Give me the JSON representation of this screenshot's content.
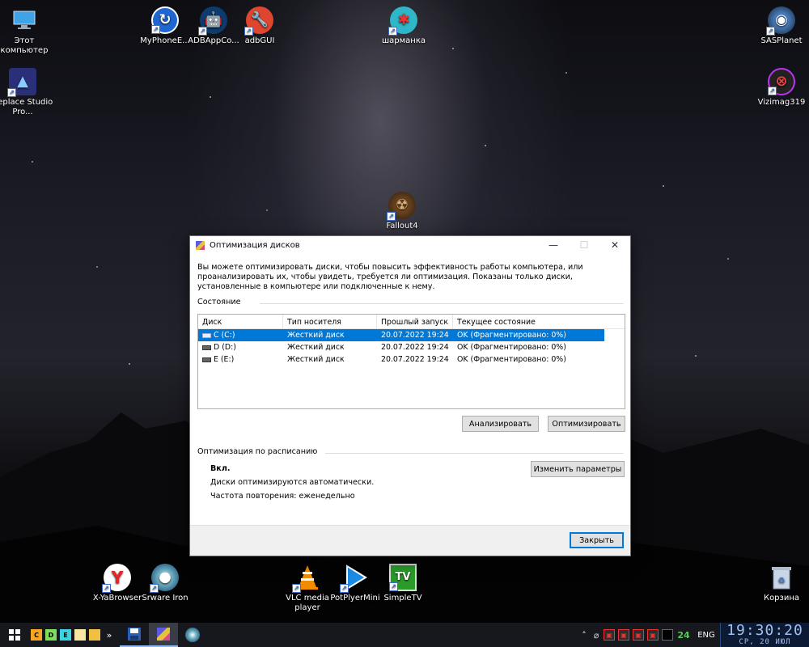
{
  "desktop": {
    "icons": [
      {
        "label": "Этот компьютер"
      },
      {
        "label": "Replace Studio Pro..."
      },
      {
        "label": "MyPhoneE..."
      },
      {
        "label": "ADBAppCo..."
      },
      {
        "label": "adbGUI"
      },
      {
        "label": "шарманка"
      },
      {
        "label": "Fallout4"
      },
      {
        "label": "SASPlanet"
      },
      {
        "label": "Vizimag319"
      },
      {
        "label": "X-YaBrowser"
      },
      {
        "label": "Srware Iron"
      },
      {
        "label": "VLC media player"
      },
      {
        "label": "PotPlyerMini"
      },
      {
        "label": "SimpleTV"
      },
      {
        "label": "Корзина"
      }
    ]
  },
  "dialog": {
    "title": "Оптимизация дисков",
    "minimize": "—",
    "maximize": "☐",
    "close": "✕",
    "description": "Вы можете оптимизировать диски, чтобы повысить эффективность работы  компьютера, или проанализировать их, чтобы увидеть, требуется ли оптимизация. Показаны только диски, установленные в компьютере или подключенные к нему.",
    "status_label": "Состояние",
    "columns": [
      "Диск",
      "Тип носителя",
      "Прошлый запуск",
      "Текущее состояние"
    ],
    "rows": [
      {
        "disk": "C (C:)",
        "media": "Жесткий диск",
        "last_run": "20.07.2022 19:24",
        "state": "OK (Фрагментировано: 0%)"
      },
      {
        "disk": "D (D:)",
        "media": "Жесткий диск",
        "last_run": "20.07.2022 19:24",
        "state": "OK (Фрагментировано: 0%)"
      },
      {
        "disk": "E (E:)",
        "media": "Жесткий диск",
        "last_run": "20.07.2022 19:24",
        "state": "OK (Фрагментировано: 0%)"
      }
    ],
    "analyze_button": "Анализировать",
    "optimize_button": "Оптимизировать",
    "schedule_label": "Оптимизация по расписанию",
    "schedule_state": "Вкл.",
    "schedule_auto": "Диски оптимизируются автоматически.",
    "schedule_freq": "Частота повторения: еженедельно",
    "change_settings_button": "Изменить параметры",
    "close_button": "Закрыть"
  },
  "taskbar": {
    "quick_letters": [
      "C",
      "D",
      "E"
    ],
    "overflow": "»",
    "tray_number": "24",
    "language": "ENG",
    "time": "19:30:20",
    "date": "СР, 20 ИЮЛ"
  },
  "colors": {
    "selection": "#0078d7",
    "tent_green": "#9be23a",
    "clock_text": "#9fc0f0"
  }
}
